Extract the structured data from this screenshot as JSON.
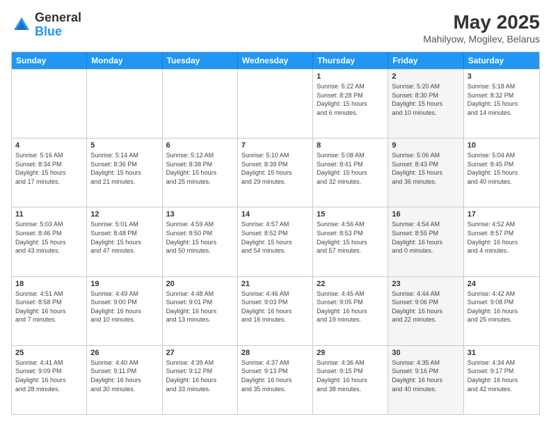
{
  "header": {
    "logo_general": "General",
    "logo_blue": "Blue",
    "title": "May 2025",
    "subtitle": "Mahilyow, Mogilev, Belarus"
  },
  "weekdays": [
    "Sunday",
    "Monday",
    "Tuesday",
    "Wednesday",
    "Thursday",
    "Friday",
    "Saturday"
  ],
  "rows": [
    [
      {
        "day": "",
        "info": "",
        "shaded": false
      },
      {
        "day": "",
        "info": "",
        "shaded": false
      },
      {
        "day": "",
        "info": "",
        "shaded": false
      },
      {
        "day": "",
        "info": "",
        "shaded": false
      },
      {
        "day": "1",
        "info": "Sunrise: 5:22 AM\nSunset: 8:28 PM\nDaylight: 15 hours\nand 6 minutes.",
        "shaded": false
      },
      {
        "day": "2",
        "info": "Sunrise: 5:20 AM\nSunset: 8:30 PM\nDaylight: 15 hours\nand 10 minutes.",
        "shaded": true
      },
      {
        "day": "3",
        "info": "Sunrise: 5:18 AM\nSunset: 8:32 PM\nDaylight: 15 hours\nand 14 minutes.",
        "shaded": false
      }
    ],
    [
      {
        "day": "4",
        "info": "Sunrise: 5:16 AM\nSunset: 8:34 PM\nDaylight: 15 hours\nand 17 minutes.",
        "shaded": false
      },
      {
        "day": "5",
        "info": "Sunrise: 5:14 AM\nSunset: 8:36 PM\nDaylight: 15 hours\nand 21 minutes.",
        "shaded": false
      },
      {
        "day": "6",
        "info": "Sunrise: 5:12 AM\nSunset: 8:38 PM\nDaylight: 15 hours\nand 25 minutes.",
        "shaded": false
      },
      {
        "day": "7",
        "info": "Sunrise: 5:10 AM\nSunset: 8:39 PM\nDaylight: 15 hours\nand 29 minutes.",
        "shaded": false
      },
      {
        "day": "8",
        "info": "Sunrise: 5:08 AM\nSunset: 8:41 PM\nDaylight: 15 hours\nand 32 minutes.",
        "shaded": false
      },
      {
        "day": "9",
        "info": "Sunrise: 5:06 AM\nSunset: 8:43 PM\nDaylight: 15 hours\nand 36 minutes.",
        "shaded": true
      },
      {
        "day": "10",
        "info": "Sunrise: 5:04 AM\nSunset: 8:45 PM\nDaylight: 15 hours\nand 40 minutes.",
        "shaded": false
      }
    ],
    [
      {
        "day": "11",
        "info": "Sunrise: 5:03 AM\nSunset: 8:46 PM\nDaylight: 15 hours\nand 43 minutes.",
        "shaded": false
      },
      {
        "day": "12",
        "info": "Sunrise: 5:01 AM\nSunset: 8:48 PM\nDaylight: 15 hours\nand 47 minutes.",
        "shaded": false
      },
      {
        "day": "13",
        "info": "Sunrise: 4:59 AM\nSunset: 8:50 PM\nDaylight: 15 hours\nand 50 minutes.",
        "shaded": false
      },
      {
        "day": "14",
        "info": "Sunrise: 4:57 AM\nSunset: 8:52 PM\nDaylight: 15 hours\nand 54 minutes.",
        "shaded": false
      },
      {
        "day": "15",
        "info": "Sunrise: 4:56 AM\nSunset: 8:53 PM\nDaylight: 15 hours\nand 57 minutes.",
        "shaded": false
      },
      {
        "day": "16",
        "info": "Sunrise: 4:54 AM\nSunset: 8:55 PM\nDaylight: 16 hours\nand 0 minutes.",
        "shaded": true
      },
      {
        "day": "17",
        "info": "Sunrise: 4:52 AM\nSunset: 8:57 PM\nDaylight: 16 hours\nand 4 minutes.",
        "shaded": false
      }
    ],
    [
      {
        "day": "18",
        "info": "Sunrise: 4:51 AM\nSunset: 8:58 PM\nDaylight: 16 hours\nand 7 minutes.",
        "shaded": false
      },
      {
        "day": "19",
        "info": "Sunrise: 4:49 AM\nSunset: 9:00 PM\nDaylight: 16 hours\nand 10 minutes.",
        "shaded": false
      },
      {
        "day": "20",
        "info": "Sunrise: 4:48 AM\nSunset: 9:01 PM\nDaylight: 16 hours\nand 13 minutes.",
        "shaded": false
      },
      {
        "day": "21",
        "info": "Sunrise: 4:46 AM\nSunset: 9:03 PM\nDaylight: 16 hours\nand 16 minutes.",
        "shaded": false
      },
      {
        "day": "22",
        "info": "Sunrise: 4:45 AM\nSunset: 9:05 PM\nDaylight: 16 hours\nand 19 minutes.",
        "shaded": false
      },
      {
        "day": "23",
        "info": "Sunrise: 4:44 AM\nSunset: 9:06 PM\nDaylight: 16 hours\nand 22 minutes.",
        "shaded": true
      },
      {
        "day": "24",
        "info": "Sunrise: 4:42 AM\nSunset: 9:08 PM\nDaylight: 16 hours\nand 25 minutes.",
        "shaded": false
      }
    ],
    [
      {
        "day": "25",
        "info": "Sunrise: 4:41 AM\nSunset: 9:09 PM\nDaylight: 16 hours\nand 28 minutes.",
        "shaded": false
      },
      {
        "day": "26",
        "info": "Sunrise: 4:40 AM\nSunset: 9:11 PM\nDaylight: 16 hours\nand 30 minutes.",
        "shaded": false
      },
      {
        "day": "27",
        "info": "Sunrise: 4:39 AM\nSunset: 9:12 PM\nDaylight: 16 hours\nand 33 minutes.",
        "shaded": false
      },
      {
        "day": "28",
        "info": "Sunrise: 4:37 AM\nSunset: 9:13 PM\nDaylight: 16 hours\nand 35 minutes.",
        "shaded": false
      },
      {
        "day": "29",
        "info": "Sunrise: 4:36 AM\nSunset: 9:15 PM\nDaylight: 16 hours\nand 38 minutes.",
        "shaded": false
      },
      {
        "day": "30",
        "info": "Sunrise: 4:35 AM\nSunset: 9:16 PM\nDaylight: 16 hours\nand 40 minutes.",
        "shaded": true
      },
      {
        "day": "31",
        "info": "Sunrise: 4:34 AM\nSunset: 9:17 PM\nDaylight: 16 hours\nand 42 minutes.",
        "shaded": false
      }
    ]
  ]
}
